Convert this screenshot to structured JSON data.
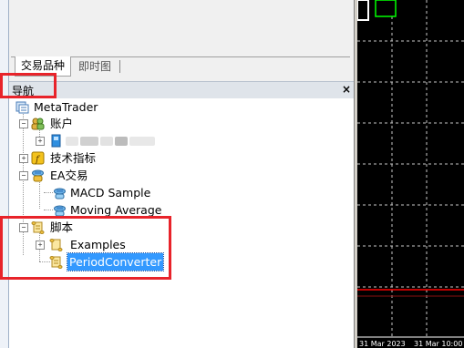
{
  "market_watch": {
    "tabs": [
      {
        "label": "交易品种"
      },
      {
        "label": "即时图"
      }
    ]
  },
  "navigator": {
    "title": "导航",
    "close_glyph": "×",
    "root": {
      "label": "MetaTrader",
      "icon": "metatrader-icon"
    },
    "accounts": {
      "label": "账户",
      "icon": "accounts-icon",
      "expander": "−"
    },
    "account_item": {
      "expander": "+",
      "icon": "account-icon"
    },
    "indicators": {
      "label": "技术指标",
      "icon": "indicators-icon",
      "expander": "+"
    },
    "experts": {
      "label": "EA交易",
      "icon": "experts-icon",
      "expander": "−",
      "items": [
        {
          "label": "MACD Sample"
        },
        {
          "label": "Moving Average"
        }
      ]
    },
    "scripts": {
      "label": "脚本",
      "icon": "scripts-icon",
      "expander": "−",
      "items": [
        {
          "label": "Examples",
          "expander": "+"
        },
        {
          "label": "PeriodConverter",
          "selected": true
        }
      ]
    }
  },
  "chart": {
    "background": "#000000",
    "grid_color": "#c8c8c8",
    "candle_color": "#00ff00",
    "price_line_color": "#ff0000",
    "time_labels": [
      "31 Mar 2023",
      "31 Mar 10:00"
    ]
  },
  "highlight_color": "#e8232a"
}
